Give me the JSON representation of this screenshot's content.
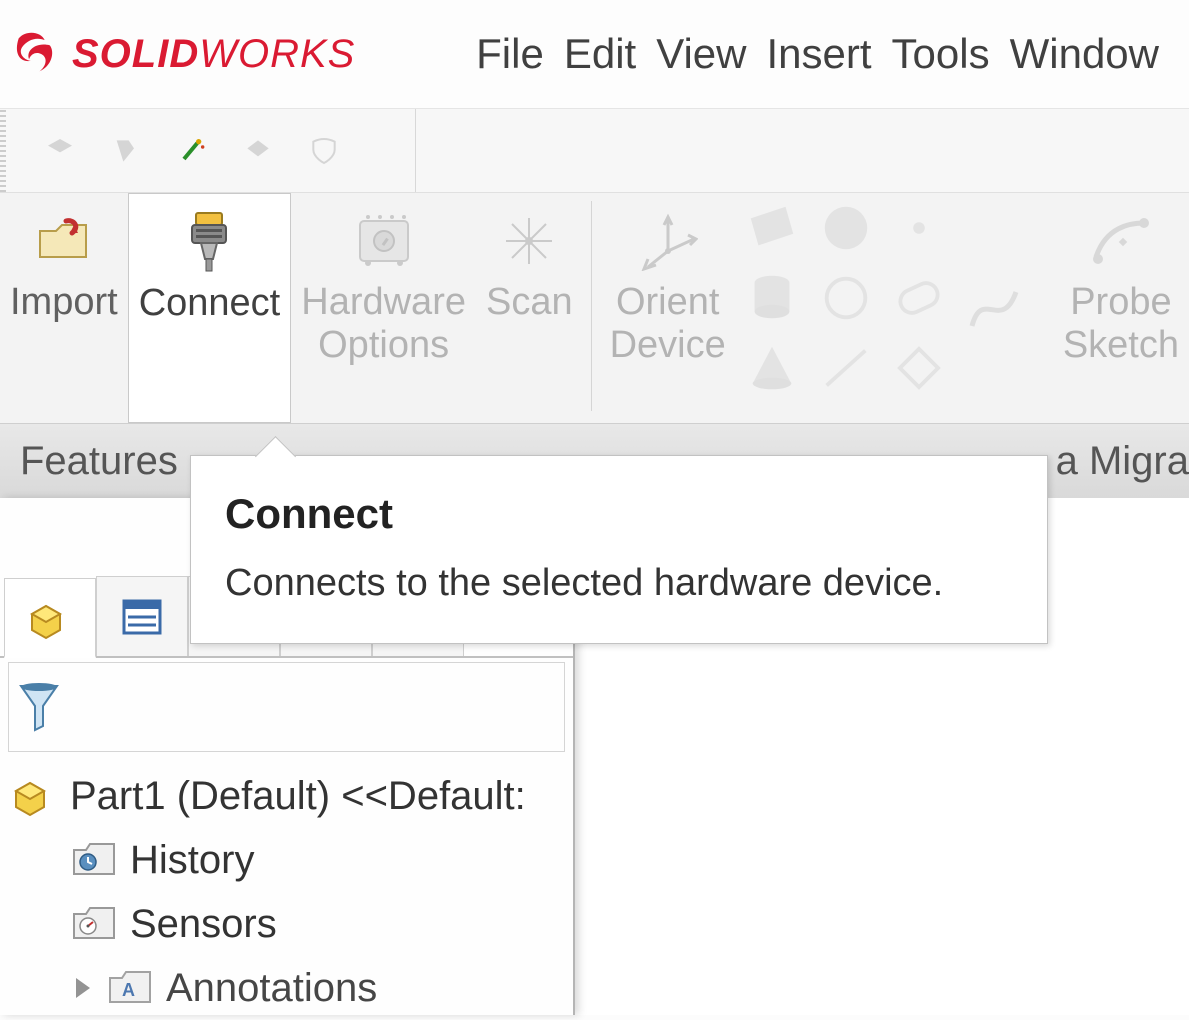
{
  "brand": {
    "bold": "SOLID",
    "light": "WORKS"
  },
  "menus": [
    "File",
    "Edit",
    "View",
    "Insert",
    "Tools",
    "Window"
  ],
  "ribbon": {
    "import": "Import",
    "connect": "Connect",
    "hardware1": "Hardware",
    "hardware2": "Options",
    "scan": "Scan",
    "orient1": "Orient",
    "orient2": "Device",
    "probe1": "Probe",
    "probe2": "Sketch"
  },
  "tabs": {
    "features": "Features",
    "migration": "a Migra"
  },
  "tooltip": {
    "title": "Connect",
    "body": "Connects to the selected hardware device."
  },
  "tree": {
    "root": "Part1 (Default) <<Default:",
    "history": "History",
    "sensors": "Sensors",
    "annotations": "Annotations"
  }
}
